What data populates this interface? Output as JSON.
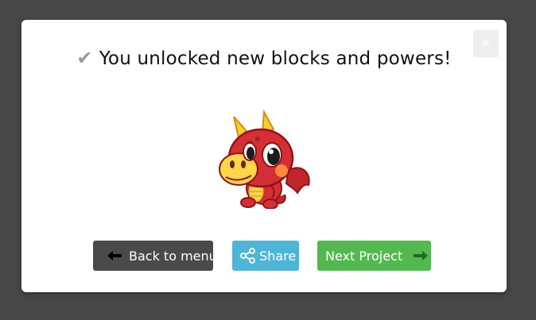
{
  "dialog": {
    "close_label": "×",
    "title": "You unlocked new blocks and powers!",
    "check_icon": "checkmark-icon",
    "mascot": "red-dragon-character"
  },
  "buttons": {
    "back": {
      "label": "Back to menu",
      "icon": "arrow-left-icon",
      "color": "#4a4a4a"
    },
    "share": {
      "label": "Share",
      "icon": "share-icon",
      "color": "#4fb5d6"
    },
    "next": {
      "label": "Next Project",
      "icon": "arrow-right-icon",
      "color": "#53b84f"
    }
  }
}
